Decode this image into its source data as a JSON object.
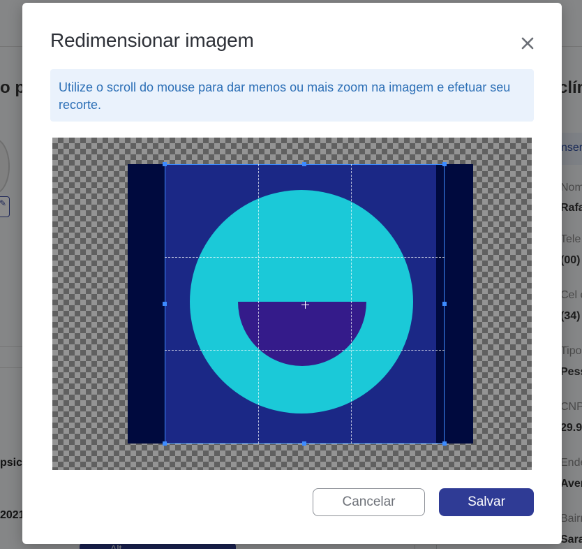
{
  "background": {
    "left_heading": "o p",
    "right_heading": "clín",
    "left_lines": [
      {
        "text": "psic"
      },
      {
        "text": "2021"
      }
    ],
    "bottom_button_label": "Alt",
    "right_card_text": "nser",
    "fields": [
      {
        "label": "Nom",
        "value": "Rafa"
      },
      {
        "label": "Tele",
        "value": "(00)"
      },
      {
        "label": "Cel c",
        "value": "(34)"
      },
      {
        "label": "Tipo",
        "value": "Pess"
      },
      {
        "label": "CNP",
        "value": "29.9"
      },
      {
        "label": "Ende",
        "value": "Aven"
      },
      {
        "label": "Bairr",
        "value": "Sara"
      }
    ]
  },
  "modal": {
    "title": "Redimensionar imagem",
    "close_icon": "close-icon",
    "info_text": "Utilize o scroll do mouse para dar menos ou mais zoom na imagem e efetuar seu recorte.",
    "cancel_label": "Cancelar",
    "save_label": "Salvar"
  },
  "colors": {
    "primary": "#2f3b95",
    "info_bg": "#eaf2fc",
    "info_text": "#2c6fb6",
    "crop_border": "#3d8bff",
    "image_bg": "#1b2886",
    "image_circle": "#1bc9d8",
    "image_mouth": "#341b8a"
  }
}
